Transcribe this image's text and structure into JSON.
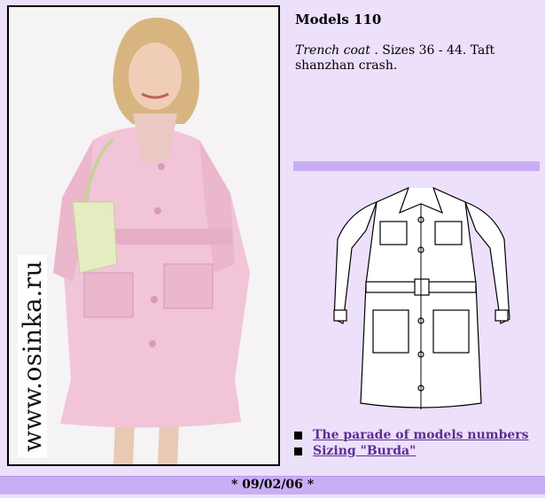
{
  "model": {
    "title": "Models 110",
    "name": "Trench coat",
    "details": " . Sizes 36 - 44. Taft shanzhan crash."
  },
  "photo": {
    "watermark": "www.osinka.ru"
  },
  "links": [
    {
      "label": "The parade of models numbers "
    },
    {
      "label": "Sizing \"Burda\""
    }
  ],
  "footer": {
    "date": "* 09/02/06 *"
  },
  "colors": {
    "page_background": "#ece0fb",
    "band": "#c9aef5",
    "link": "#5e2d91"
  }
}
